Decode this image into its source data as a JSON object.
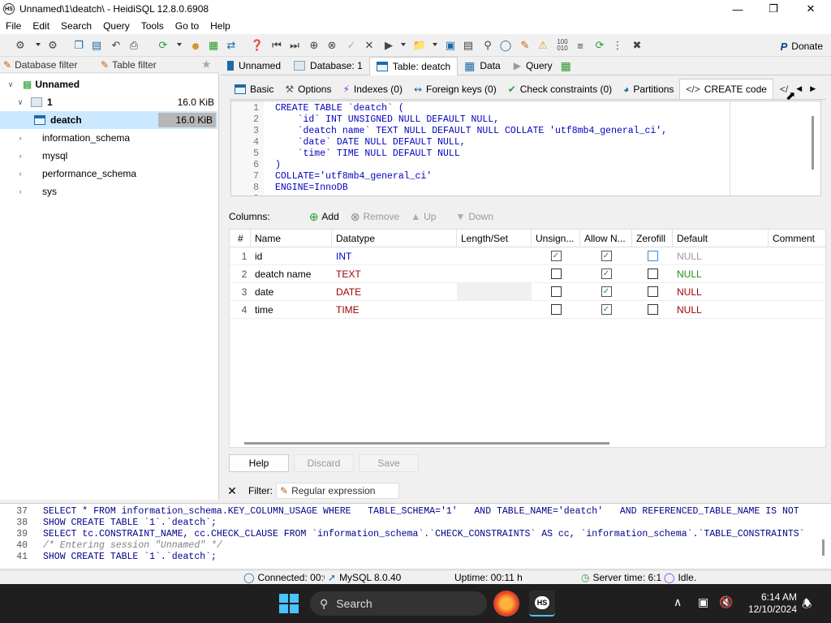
{
  "window": {
    "title": "Unnamed\\1\\deatch\\ - HeidiSQL 12.8.0.6908",
    "app_icon": "HS"
  },
  "menu": [
    "File",
    "Edit",
    "Search",
    "Query",
    "Tools",
    "Go to",
    "Help"
  ],
  "toolbar": {
    "donate_label": "Donate"
  },
  "left_filters": {
    "database_filter": "Database filter",
    "table_filter": "Table filter"
  },
  "tree": {
    "root": "Unnamed",
    "db1": {
      "name": "1",
      "size": "16.0 KiB"
    },
    "table": {
      "name": "deatch",
      "size": "16.0 KiB"
    },
    "others": [
      "information_schema",
      "mysql",
      "performance_schema",
      "sys"
    ]
  },
  "top_tabs": [
    "Unnamed",
    "Database: 1",
    "Table: deatch",
    "Data",
    "Query"
  ],
  "sub_tabs": [
    "Basic",
    "Options",
    "Indexes (0)",
    "Foreign keys (0)",
    "Check constraints (0)",
    "Partitions",
    "CREATE code"
  ],
  "code_lines": [
    "CREATE TABLE `deatch` (",
    "    `id` INT UNSIGNED NULL DEFAULT NULL,",
    "    `deatch name` TEXT NULL DEFAULT NULL COLLATE 'utf8mb4_general_ci',",
    "    `date` DATE NULL DEFAULT NULL,",
    "    `time` TIME NULL DEFAULT NULL",
    ")",
    "COLLATE='utf8mb4_general_ci'",
    "ENGINE=InnoDB",
    ""
  ],
  "columns_toolbar": {
    "label": "Columns:",
    "add": "Add",
    "remove": "Remove",
    "up": "Up",
    "down": "Down"
  },
  "grid": {
    "headers": [
      "#",
      "Name",
      "Datatype",
      "Length/Set",
      "Unsign...",
      "Allow N...",
      "Zerofill",
      "Default",
      "Comment"
    ],
    "rows": [
      {
        "num": "1",
        "name": "id",
        "type": "INT",
        "length": "",
        "unsigned": true,
        "allow_null": true,
        "zerofill": false,
        "default": "NULL"
      },
      {
        "num": "2",
        "name": "deatch name",
        "type": "TEXT",
        "length": "",
        "unsigned": false,
        "allow_null": true,
        "zerofill": false,
        "default": "NULL"
      },
      {
        "num": "3",
        "name": "date",
        "type": "DATE",
        "length": "",
        "unsigned": false,
        "allow_null": true,
        "zerofill": false,
        "default": "NULL"
      },
      {
        "num": "4",
        "name": "time",
        "type": "TIME",
        "length": "",
        "unsigned": false,
        "allow_null": true,
        "zerofill": false,
        "default": "NULL"
      }
    ]
  },
  "buttons": {
    "help": "Help",
    "discard": "Discard",
    "save": "Save"
  },
  "filter": {
    "label": "Filter:",
    "placeholder": "Regular expression"
  },
  "log_lines": [
    {
      "n": "37",
      "text": "SELECT * FROM information_schema.KEY_COLUMN_USAGE WHERE   TABLE_SCHEMA='1'   AND TABLE_NAME='deatch'   AND REFERENCED_TABLE_NAME IS NOT"
    },
    {
      "n": "38",
      "text": "SHOW CREATE TABLE `1`.`deatch`;"
    },
    {
      "n": "39",
      "text": "SELECT tc.CONSTRAINT_NAME, cc.CHECK_CLAUSE FROM `information_schema`.`CHECK_CONSTRAINTS` AS cc, `information_schema`.`TABLE_CONSTRAINTS`"
    },
    {
      "n": "40",
      "text": "/* Entering session \"Unnamed\" */"
    },
    {
      "n": "41",
      "text": "SHOW CREATE TABLE `1`.`deatch`;"
    }
  ],
  "status": {
    "connected": "Connected: 00:0",
    "server": "MySQL 8.0.40",
    "uptime": "Uptime: 00:11 h",
    "server_time": "Server time: 6:1",
    "state": "Idle."
  },
  "taskbar": {
    "search": "Search",
    "time": "6:14 AM",
    "date": "12/10/2024",
    "app_label": "HS"
  },
  "colors": {
    "keyword": "#00008b",
    "string": "#008000",
    "null_green": "#1f8f1f",
    "null_gray": "#999999",
    "type_blue": "#0000c0",
    "type_red": "#a00000",
    "selection": "#cce8ff"
  }
}
